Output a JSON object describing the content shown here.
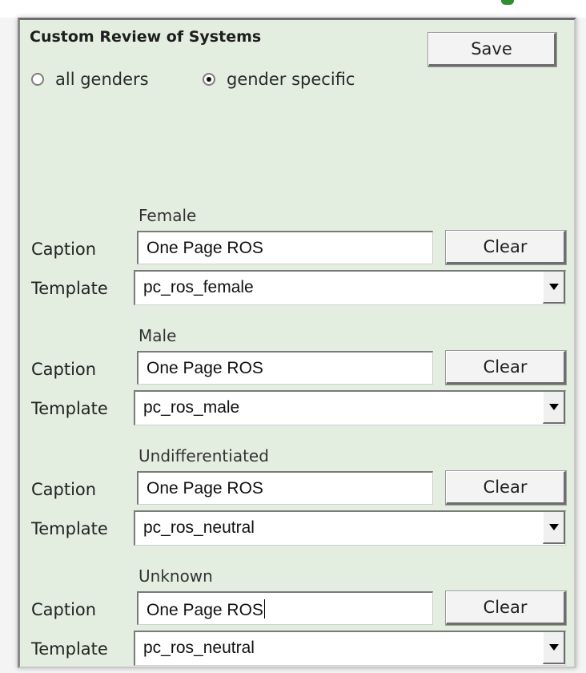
{
  "panel": {
    "title": "Custom Review of Systems",
    "save_label": "Save"
  },
  "gender_mode": {
    "options": [
      {
        "label": "all genders",
        "checked": false
      },
      {
        "label": "gender specific",
        "checked": true
      }
    ]
  },
  "labels": {
    "caption": "Caption",
    "template": "Template",
    "clear": "Clear"
  },
  "sections": [
    {
      "heading": "Female",
      "caption_value": "One Page ROS",
      "template_value": "pc_ros_female"
    },
    {
      "heading": "Male",
      "caption_value": "One Page ROS",
      "template_value": "pc_ros_male"
    },
    {
      "heading": "Undifferentiated",
      "caption_value": "One Page ROS",
      "template_value": "pc_ros_neutral"
    },
    {
      "heading": "Unknown",
      "caption_value": "One Page ROS",
      "template_value": "pc_ros_neutral"
    }
  ]
}
